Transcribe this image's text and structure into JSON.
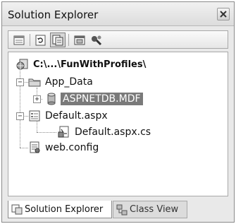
{
  "window": {
    "title": "Solution Explorer"
  },
  "toolbar": {
    "buttons": [
      {
        "icon": "properties-icon"
      },
      {
        "icon": "refresh-icon"
      },
      {
        "icon": "show-all-files-icon"
      },
      {
        "icon": "view-designer-icon"
      },
      {
        "icon": "asp-net-configuration-icon"
      }
    ]
  },
  "tree": {
    "root": {
      "label": "C:\\...\\FunWithProfiles\\",
      "icon": "website-icon"
    },
    "items": [
      {
        "label": "App_Data",
        "icon": "folder-icon",
        "expanded": true
      },
      {
        "label": "ASPNETDB.MDF",
        "icon": "database-icon",
        "selected": true
      },
      {
        "label": "Default.aspx",
        "icon": "web-form-icon",
        "expanded": true
      },
      {
        "label": "Default.aspx.cs",
        "icon": "code-file-icon"
      },
      {
        "label": "web.config",
        "icon": "config-file-icon"
      }
    ]
  },
  "tabs": [
    {
      "label": "Solution Explorer",
      "active": true
    },
    {
      "label": "Class View",
      "active": false
    }
  ]
}
